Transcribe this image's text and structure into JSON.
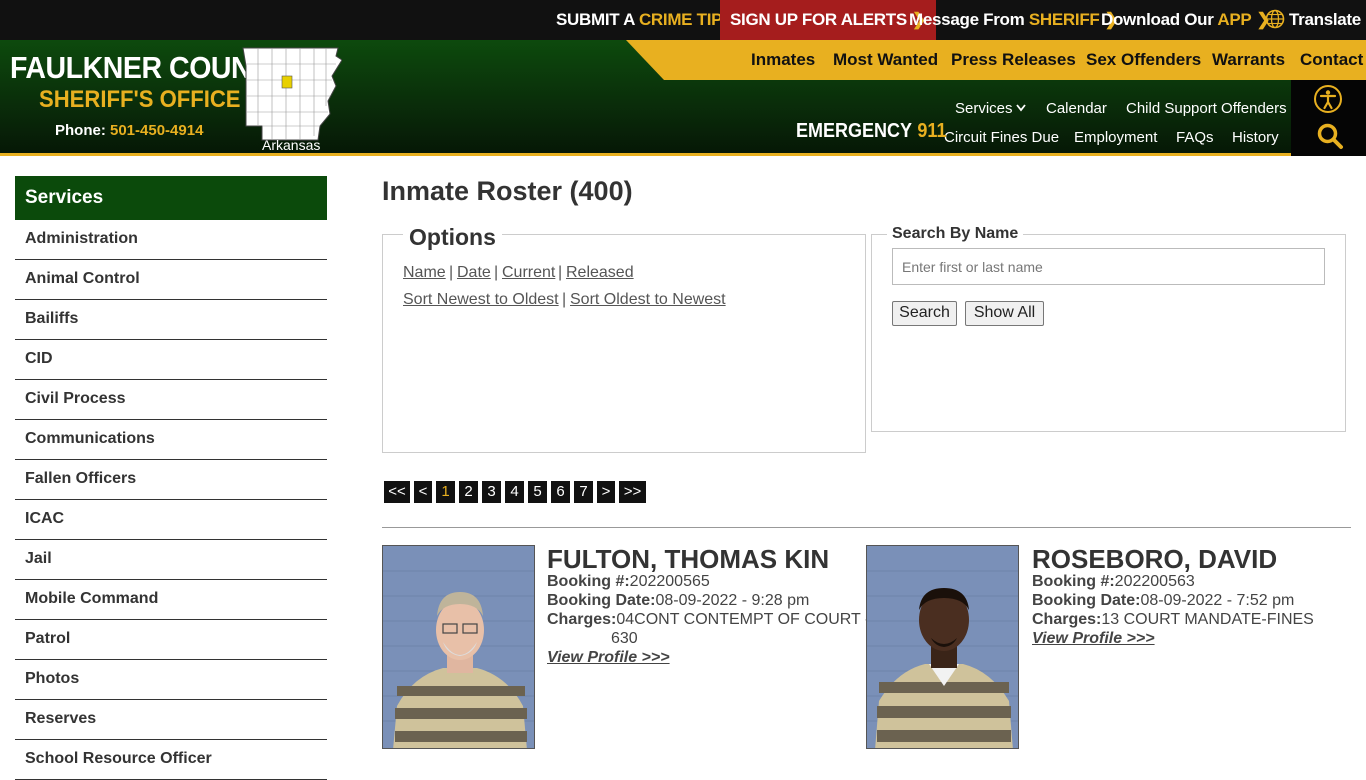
{
  "topbar": {
    "crime_tip_pre": "SUBMIT A ",
    "crime_tip_hl": "CRIME TIP",
    "alerts": "SIGN UP FOR ALERTS",
    "message_pre": "Message From ",
    "message_hl": "SHERIFF",
    "download_pre": "Download Our ",
    "download_hl": "APP",
    "translate": "Translate",
    "chevron": "❯"
  },
  "logo": {
    "title": "FAULKNER COUNTY",
    "subtitle": "SHERIFF'S OFFICE",
    "phone_label": "Phone: ",
    "phone": "501-450-4914",
    "map_label": "Arkansas"
  },
  "nav_primary": [
    "Inmates",
    "Most Wanted",
    "Press Releases",
    "Sex Offenders",
    "Warrants",
    "Contact"
  ],
  "nav_secondary": {
    "services": "Services",
    "calendar": "Calendar",
    "child_support": "Child Support Offenders",
    "circuit": "Circuit Fines Due",
    "employment": "Employment",
    "faqs": "FAQs",
    "history": "History"
  },
  "emergency": {
    "label": "EMERGENCY",
    "number": "911"
  },
  "sidebar": {
    "title": "Services",
    "items": [
      "Administration",
      "Animal Control",
      "Bailiffs",
      "CID",
      "Civil Process",
      "Communications",
      "Fallen Officers",
      "ICAC",
      "Jail",
      "Mobile Command",
      "Patrol",
      "Photos",
      "Reserves",
      "School Resource Officer"
    ]
  },
  "main": {
    "title": "Inmate Roster (400)",
    "options": {
      "legend": "Options",
      "name": "Name",
      "date": "Date",
      "current": "Current",
      "released": "Released",
      "newest": "Sort Newest to Oldest",
      "oldest": "Sort Oldest to Newest",
      "sep": "|"
    },
    "search": {
      "legend": "Search By Name",
      "placeholder": "Enter first or last name",
      "search_btn": "Search",
      "show_all_btn": "Show All"
    },
    "pagination": {
      "first": "<<",
      "prev": "<",
      "pages": [
        "1",
        "2",
        "3",
        "4",
        "5",
        "6",
        "7"
      ],
      "current": "1",
      "next": ">",
      "last": ">>"
    },
    "inmates": [
      {
        "name": "FULTON, THOMAS KIN",
        "booking_label": "Booking #:",
        "booking": "202200565",
        "date_label": "Booking Date:",
        "date": "08-09-2022 - 9:28 pm",
        "charges_label": "Charges:",
        "charges_line1": "04CONT CONTEMPT OF COURT -",
        "charges_line2": "630",
        "profile": "View Profile >>>"
      },
      {
        "name": "ROSEBORO, DAVID",
        "booking_label": "Booking #:",
        "booking": "202200563",
        "date_label": "Booking Date:",
        "date": "08-09-2022 - 7:52 pm",
        "charges_label": "Charges:",
        "charges_line1": "13 COURT MANDATE-FINES",
        "profile": "View Profile >>>"
      }
    ]
  },
  "colors": {
    "green": "#0b4a0b",
    "gold": "#e8b020",
    "alert_red": "#a51d1d",
    "topbar": "#111111"
  }
}
